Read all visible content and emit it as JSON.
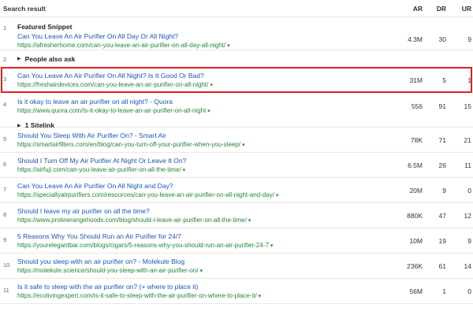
{
  "header": {
    "result_label": "Search result",
    "col_ar": "AR",
    "col_dr": "DR",
    "col_ur": "UR"
  },
  "featured": {
    "num": "1",
    "label": "Featured Snippet",
    "title": "Can You Leave An Air Purifier On All Day Or All Night?",
    "url": "https://afresherhome.com/can-you-leave-an-air-purifier-on-all-day-all-night/",
    "ar": "4.3M",
    "dr": "30",
    "ur": "9"
  },
  "paa": {
    "num": "2",
    "label": "People also ask"
  },
  "results": [
    {
      "num": "3",
      "title": "Can You Leave An Air Purifier On All Night? Is It Good Or Bad?",
      "url": "https://freshairdevices.com/can-you-leave-an-air-purifier-on-all-night/",
      "ar": "31M",
      "dr": "5",
      "ur": "1",
      "highlighted": true
    },
    {
      "num": "4",
      "title": "Is it okay to leave an air purifier on all night? - Quora",
      "url": "https://www.quora.com/Is-it-okay-to-leave-an-air-purifier-on-all-night",
      "ar": "556",
      "dr": "91",
      "ur": "15",
      "sitelink": "1 Sitelink"
    },
    {
      "num": "5",
      "title": "Should You Sleep With Air Purifier On? - Smart Air",
      "url": "https://smartairfilters.com/en/blog/can-you-turn-off-your-purifier-when-you-sleep/",
      "ar": "78K",
      "dr": "71",
      "ur": "21"
    },
    {
      "num": "6",
      "title": "Should I Turn Off My Air Purifier At Night Or Leave It On?",
      "url": "https://airfuji.com/can-you-leave-air-purifier-on-all-the-time/",
      "ar": "6.5M",
      "dr": "26",
      "ur": "11"
    },
    {
      "num": "7",
      "title": "Can You Leave An Air Purifier On All Night and Day?",
      "url": "https://specialtyairpurifiers.com/resources/can-you-leave-an-air-purifier-on-all-night-and-day/",
      "ar": "20M",
      "dr": "9",
      "ur": "0"
    },
    {
      "num": "8",
      "title": "Should I leave my air purifier on all the time?",
      "url": "https://www.prolinerangehoods.com/blog/should-i-leave-air-purifier-on-all-the-time/",
      "ar": "880K",
      "dr": "47",
      "ur": "12"
    },
    {
      "num": "9",
      "title": "5 Reasons Why You Should Run an Air Purifier for 24/7",
      "url": "https://yourelegantbar.com/blogs/cigars/5-reasons-why-you-should-run-an-air-purifier-24-7",
      "ar": "10M",
      "dr": "19",
      "ur": "9"
    },
    {
      "num": "10",
      "title": "Should you sleep with an air purifier on? - Molekule Blog",
      "url": "https://molekule.science/should-you-sleep-with-an-air-purifier-on/",
      "ar": "236K",
      "dr": "61",
      "ur": "14"
    },
    {
      "num": "11",
      "title": "Is it safe to sleep with the air purifier on? (+ where to place it)",
      "url": "https://ecolivingexpert.com/is-it-safe-to-sleep-with-the-air-purifier-on-where-to-place-it/",
      "ar": "56M",
      "dr": "1",
      "ur": "0"
    }
  ],
  "icons": {
    "dropdown": "▾",
    "expand": "▶"
  },
  "colors": {
    "link": "#1a56b8",
    "url": "#23853a",
    "highlight": "#e02020"
  }
}
